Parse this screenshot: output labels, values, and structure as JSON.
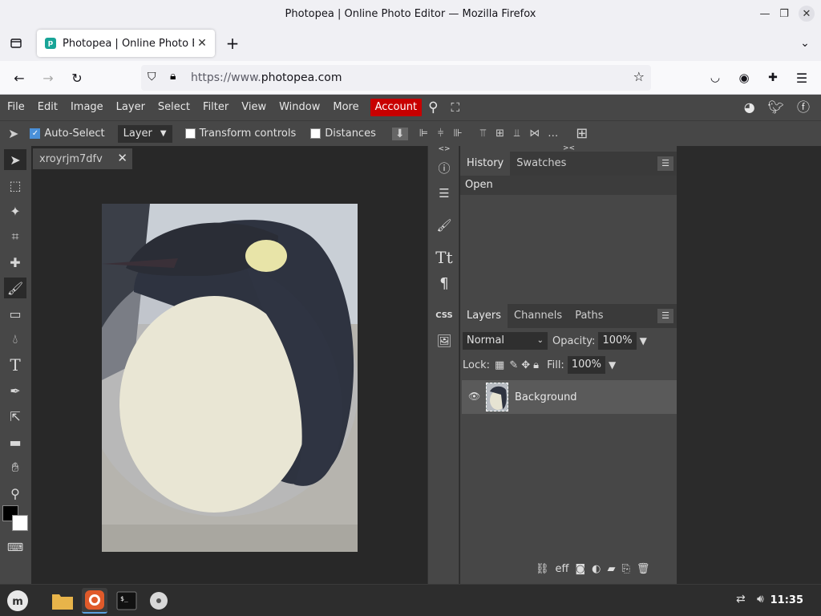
{
  "window": {
    "title": "Photopea | Online Photo Editor — Mozilla Firefox"
  },
  "browser": {
    "tab_title": "Photopea | Online Photo Ed",
    "url_prefix": "https://www.",
    "url_domain": "photopea.com"
  },
  "menu": {
    "items": [
      "File",
      "Edit",
      "Image",
      "Layer",
      "Select",
      "Filter",
      "View",
      "Window",
      "More"
    ],
    "account": "Account"
  },
  "options": {
    "auto_select": "Auto-Select",
    "auto_select_target": "Layer",
    "transform_controls": "Transform controls",
    "distances": "Distances"
  },
  "document": {
    "tab_name": "xroyrjm7dfv"
  },
  "history_panel": {
    "tabs": [
      "History",
      "Swatches"
    ],
    "items": [
      "Open"
    ]
  },
  "layers_panel": {
    "tabs": [
      "Layers",
      "Channels",
      "Paths"
    ],
    "blend_mode": "Normal",
    "opacity_label": "Opacity:",
    "opacity": "100%",
    "lock_label": "Lock:",
    "fill_label": "Fill:",
    "fill": "100%",
    "layers": [
      {
        "name": "Background"
      }
    ],
    "footer_effects": "eff"
  },
  "strip": {
    "css": "CSS"
  },
  "taskbar": {
    "clock": "11:35"
  },
  "colors": {
    "accent_red": "#c80000",
    "panel_bg": "#474747",
    "workspace_bg": "#282828"
  }
}
